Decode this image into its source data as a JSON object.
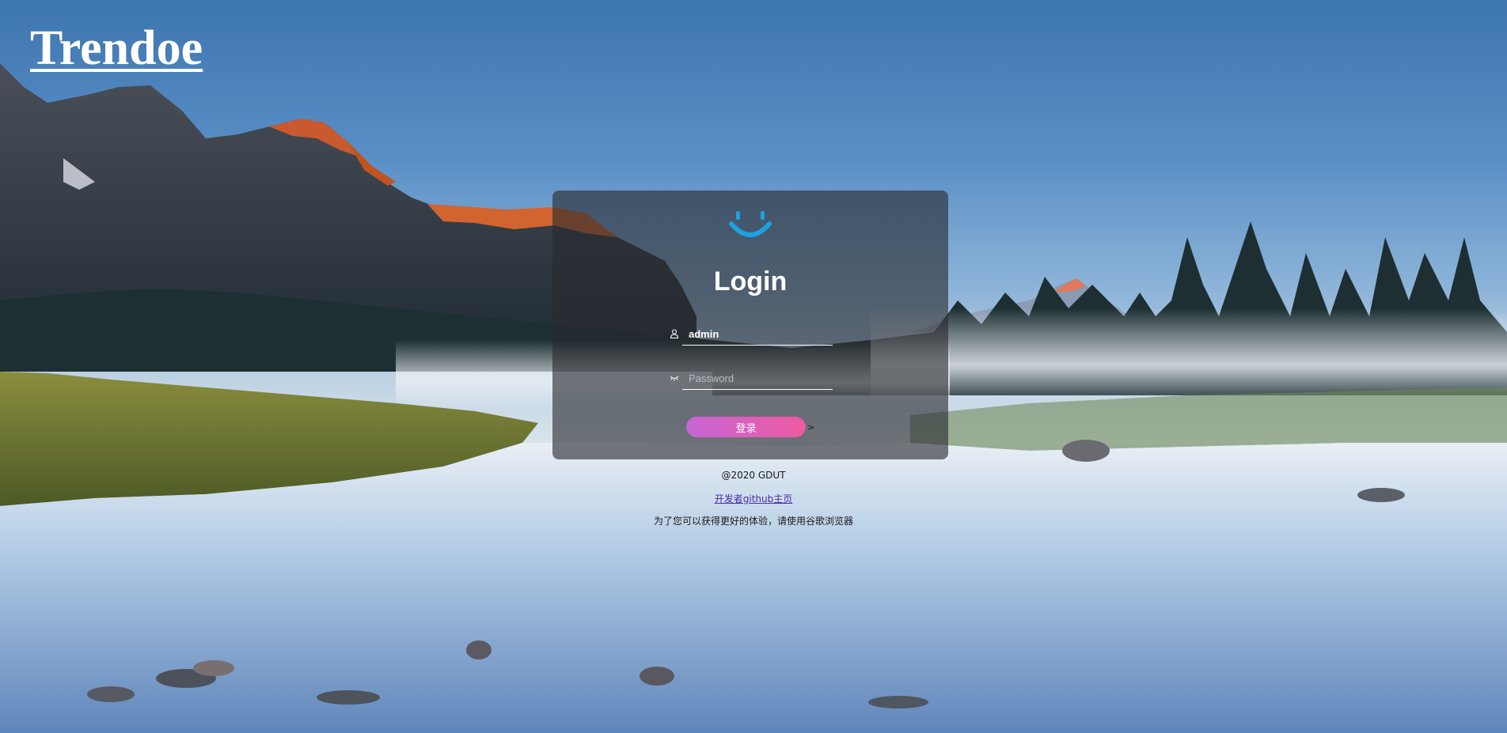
{
  "brand": {
    "name": "Trendoe"
  },
  "login": {
    "title": "Login",
    "icons": {
      "logo": "smile-icon",
      "user": "user-icon",
      "password": "eye-closed-icon"
    },
    "username": {
      "value": "admin",
      "placeholder": ""
    },
    "password": {
      "value": "",
      "placeholder": "Password"
    },
    "submit_label": "登录",
    "submit_arrow": ">"
  },
  "footer": {
    "copyright": "@2020 GDUT",
    "github_link": "开发者github主页",
    "browser_tip": "为了您可以获得更好的体验，请使用谷歌浏览器"
  },
  "colors": {
    "accent_smile": "#1da1e2",
    "button_start": "#c666d4",
    "button_end": "#ee5aa2",
    "card_bg": "rgba(40,42,46,0.62)"
  }
}
